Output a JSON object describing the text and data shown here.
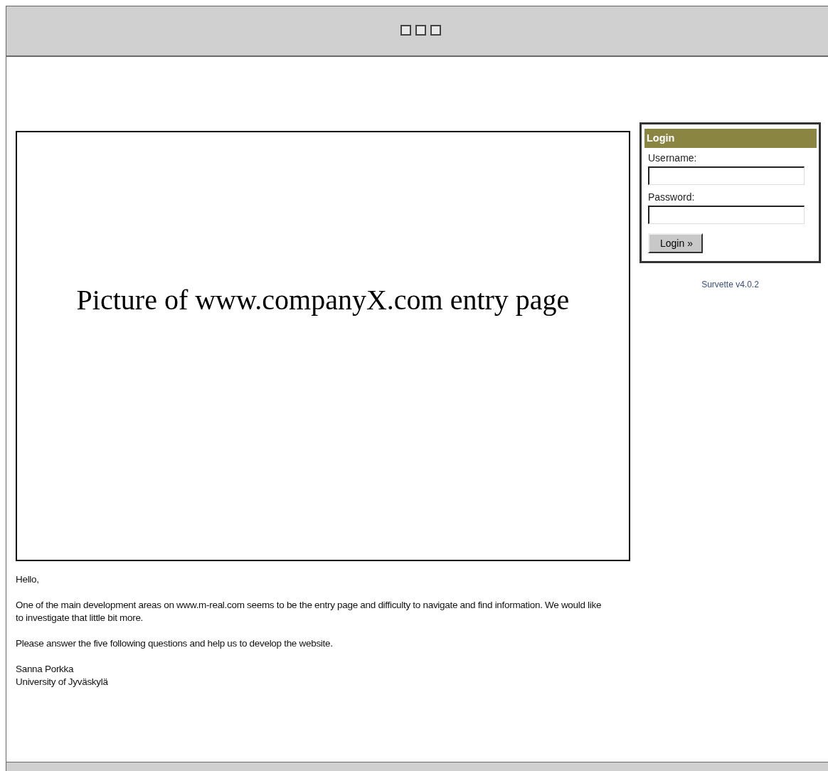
{
  "picture_box": {
    "caption": "Picture of www.companyX.com entry page"
  },
  "login": {
    "title": "Login",
    "fields": [
      {
        "label": "Username:"
      },
      {
        "label": "Password:"
      }
    ],
    "button": "Login »"
  },
  "version": "Survette v4.0.2",
  "message": [
    "Hello,",
    "One of the main development areas on www.m-real.com seems to be the entry page and difficulty to navigate and find information. We would like to investigate that little bit more.",
    "Please answer the five following questions and help us to develop the website."
  ],
  "signature": [
    "Sanna Porkka",
    "University of Jyväskylä"
  ]
}
